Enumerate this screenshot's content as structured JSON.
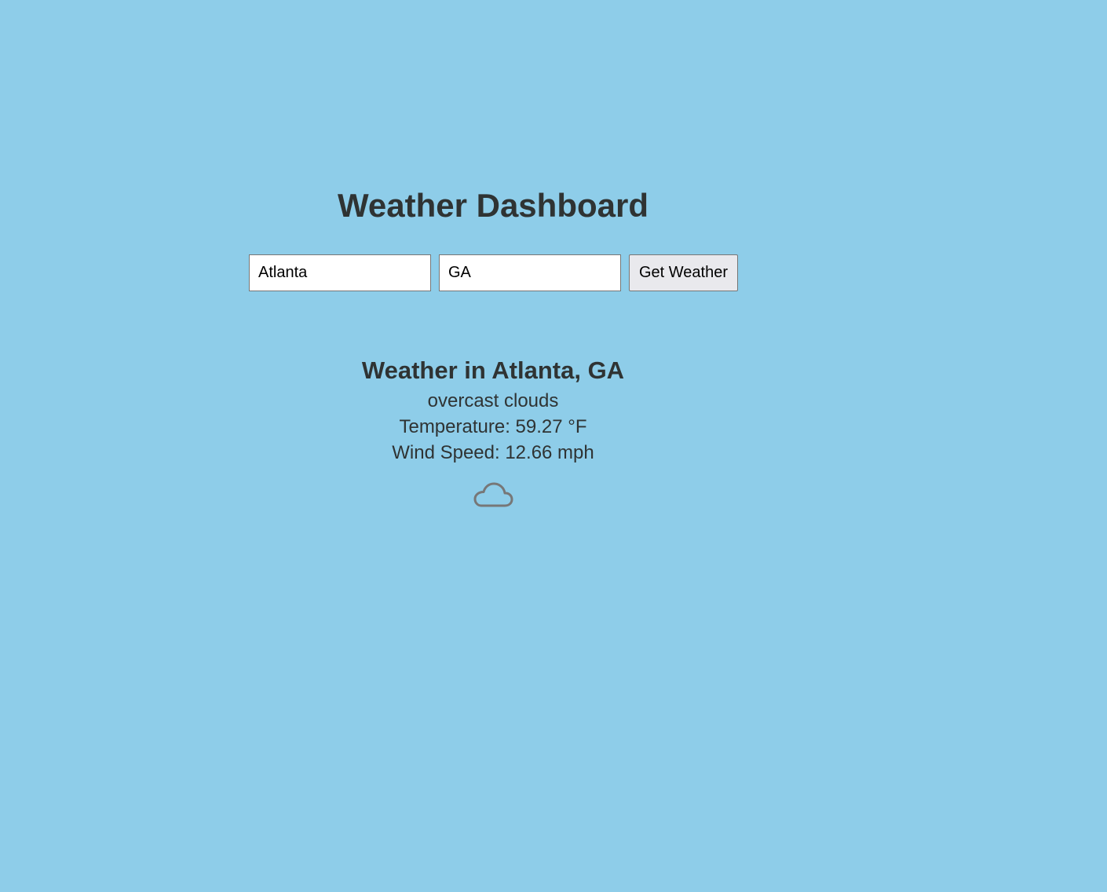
{
  "page": {
    "title": "Weather Dashboard"
  },
  "search": {
    "city_value": "Atlanta",
    "state_value": "GA",
    "button_label": "Get Weather"
  },
  "result": {
    "heading": "Weather in Atlanta, GA",
    "description": "overcast clouds",
    "temperature": "Temperature: 59.27 °F",
    "wind_speed": "Wind Speed: 12.66 mph",
    "icon": "cloud-icon"
  },
  "colors": {
    "background": "#8ecde9",
    "text": "#2f3333",
    "icon_stroke": "#777777"
  }
}
